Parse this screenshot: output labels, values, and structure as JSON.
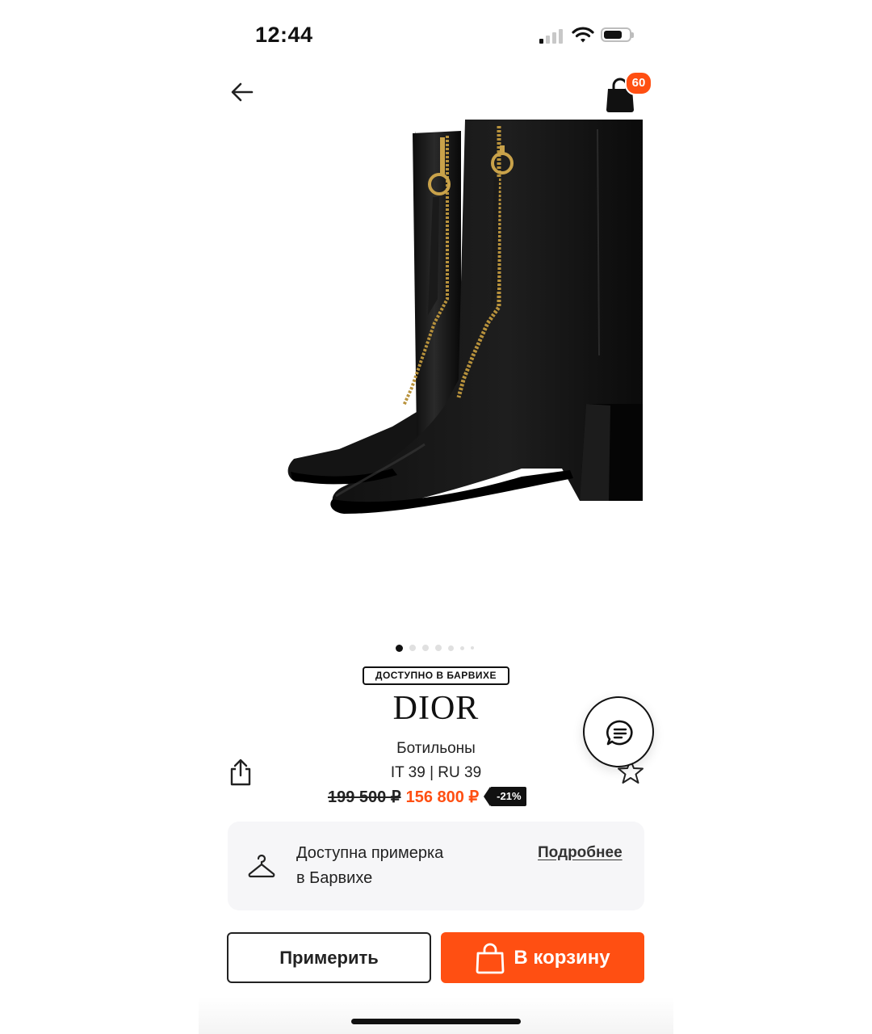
{
  "status_bar": {
    "time": "12:44",
    "signal_bars_active": 1,
    "battery_level": 0.65
  },
  "header": {
    "back_icon": "arrow-left-icon",
    "cart_icon": "shopping-bag-icon",
    "cart_count": "60"
  },
  "gallery": {
    "image_alt": "Black leather ankle boots with gold front zip",
    "image_count": 7,
    "active_index": 0
  },
  "product": {
    "availability_badge": "ДОСТУПНО В БАРВИХЕ",
    "brand": "DIOR",
    "name": "Ботильоны",
    "size": "IT 39 | RU 39",
    "old_price": "199 500 ₽",
    "new_price": "156 800 ₽",
    "discount": "-21%"
  },
  "actions": {
    "share_icon": "share-icon",
    "favorite_icon": "star-icon",
    "chat_icon": "chat-icon"
  },
  "fitting": {
    "icon": "hanger-icon",
    "text_line1": "Доступна примерка",
    "text_line2": "в Барвихе",
    "more_link": "Подробнее"
  },
  "buttons": {
    "try_on": "Примерить",
    "add_to_cart": "В корзину"
  },
  "colors": {
    "accent": "#ff4f12",
    "text": "#111111",
    "card_bg": "#f6f6f8"
  }
}
